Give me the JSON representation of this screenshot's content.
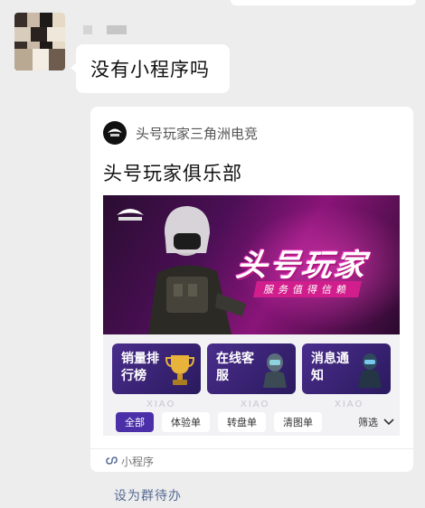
{
  "chat": {
    "message_text": "没有小程序吗",
    "set_todo_label": "设为群待办"
  },
  "mini_program": {
    "source_name": "头号玩家三角洲电竞",
    "title": "头号玩家俱乐部",
    "banner_title": "头号玩家",
    "banner_subtitle": "服务值得信赖",
    "shortcuts": [
      {
        "label": "销量排行榜",
        "icon": "trophy-icon"
      },
      {
        "label": "在线客服",
        "icon": "agent-icon"
      },
      {
        "label": "消息通知",
        "icon": "soldier-icon"
      }
    ],
    "filters": [
      "全部",
      "体验单",
      "转盘单",
      "清图单"
    ],
    "filter_more": "筛选",
    "footer_label": "小程序",
    "accent_color": "#4b2fa8"
  }
}
